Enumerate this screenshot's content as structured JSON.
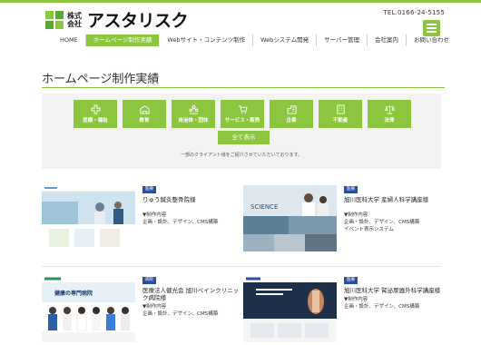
{
  "header": {
    "logo_small": "株式会社",
    "logo_text": "アスタリスク",
    "tel": "TEL.0166-24-5155"
  },
  "nav": [
    "HOME",
    "ホームページ制作実績",
    "Webサイト・コンテンツ制作",
    "Webシステム開発",
    "サーバー管理",
    "会社案内",
    "お問い合わせ"
  ],
  "page": {
    "title": "ホームページ制作実績",
    "categories": [
      "医療・福祉",
      "教育",
      "自治体・団体",
      "サービス・販売",
      "企業",
      "不動産",
      "法律"
    ],
    "show_all": "全て表示",
    "note": "一部のクライアント様をご紹介させていただいております。"
  },
  "works": [
    {
      "badge": "医療",
      "name": "りゅう鍼灸整骨院様",
      "details": [
        "▼制作内容",
        "企画・設計、デザイン、CMS構築"
      ]
    },
    {
      "badge": "医療",
      "name": "旭川医科大学 産婦人科学講座様",
      "details": [
        "▼制作内容",
        "企画・設計、デザイン、CMS構築",
        "イベント表示システム"
      ]
    },
    {
      "badge": "病院",
      "name": "医療法人健光会 旭川ペインクリニック病院様",
      "details": [
        "▼制作内容",
        "企画・設計、デザイン、CMS構築"
      ]
    },
    {
      "badge": "医療",
      "name": "旭川医科大学 腎泌尿器外科学講座様",
      "details": [
        "▼制作内容",
        "企画・設計、デザイン、CMS構築"
      ]
    }
  ],
  "thumb_texts": {
    "work1_banner": "健康の専門病院",
    "work2_banner": "SCIENCE"
  },
  "colors": {
    "accent": "#8cc63f",
    "badge": "#2b4fa0"
  }
}
